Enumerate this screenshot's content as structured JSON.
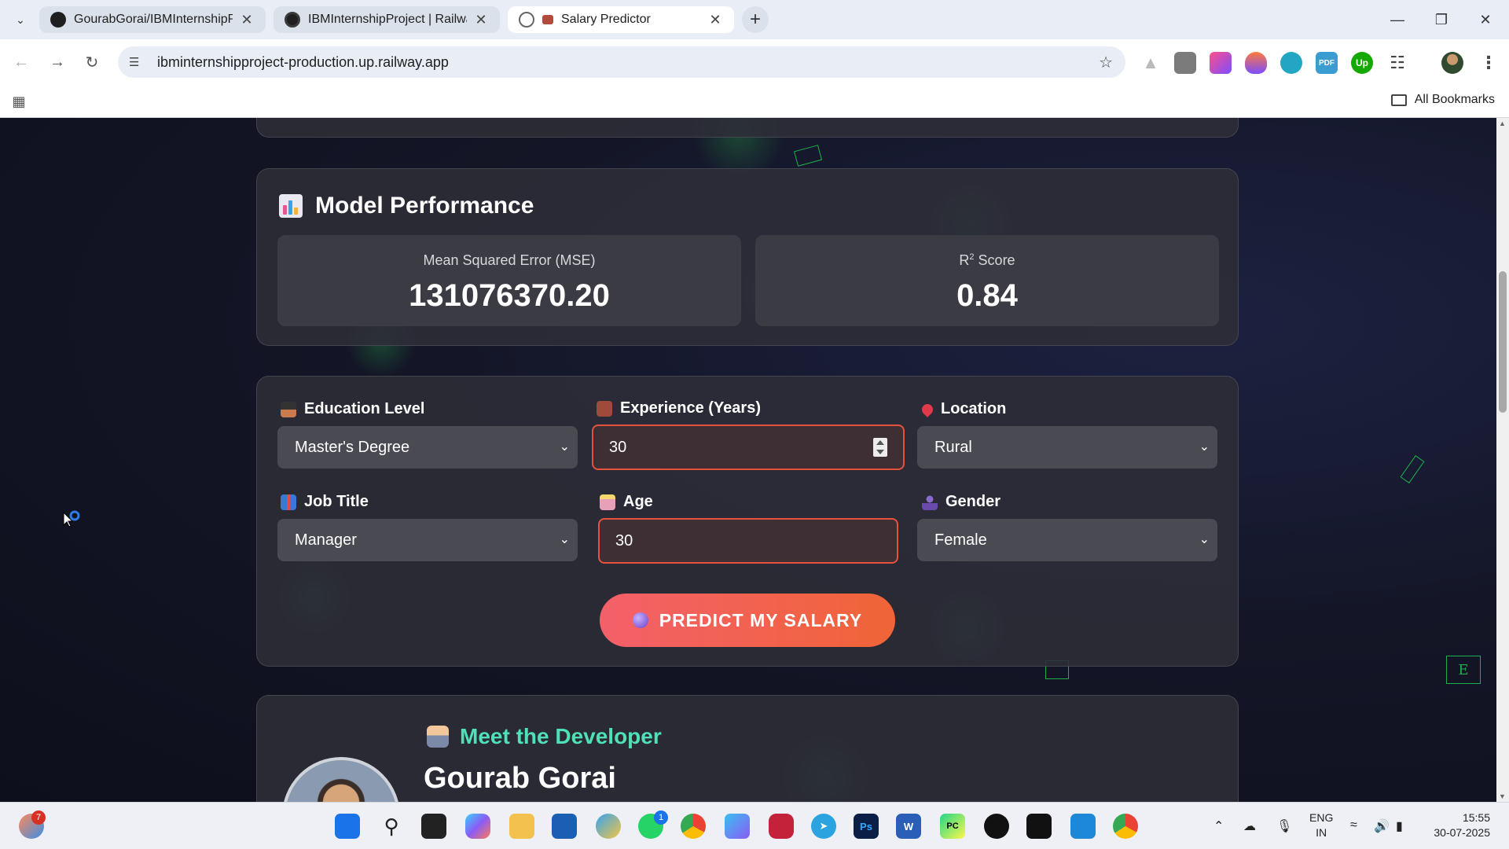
{
  "browser": {
    "tabs": [
      {
        "title": "GourabGorai/IBMInternshipProj",
        "active": false
      },
      {
        "title": "IBMInternshipProject | Railway",
        "active": false
      },
      {
        "title": "Salary Predictor",
        "active": true
      }
    ],
    "url": "ibminternshipproject-production.up.railway.app",
    "all_bookmarks": "All Bookmarks",
    "extension_labels": {
      "pdf": "PDF",
      "up": "Up"
    }
  },
  "page": {
    "performance": {
      "title": "Model Performance",
      "mse_label": "Mean Squared Error (MSE)",
      "mse_value": "131076370.20",
      "r2_label_base": "R",
      "r2_label_sup": "2",
      "r2_label_rest": " Score",
      "r2_value": "0.84"
    },
    "form": {
      "education_label": "Education Level",
      "education_value": "Master's Degree",
      "experience_label": "Experience (Years)",
      "experience_value": "30",
      "location_label": "Location",
      "location_value": "Rural",
      "job_label": "Job Title",
      "job_value": "Manager",
      "age_label": "Age",
      "age_value": "30",
      "gender_label": "Gender",
      "gender_value": "Female",
      "predict_button": "PREDICT MY SALARY"
    },
    "developer": {
      "heading": "Meet the Developer",
      "name": "Gourab Gorai"
    },
    "floating_letters": [
      "E"
    ]
  },
  "taskbar": {
    "notification_count": "7",
    "whatsapp_badge": "1",
    "lang_line1": "ENG",
    "lang_line2": "IN",
    "time": "15:55",
    "date": "30-07-2025",
    "app_labels": {
      "photoshop": "Ps",
      "word": "W",
      "pycharm": "PC"
    }
  },
  "colors": {
    "accent_green": "#4fe0b6",
    "button_gradient_start": "#f4606a",
    "button_gradient_end": "#f06437",
    "input_error_border": "#e4523c"
  }
}
